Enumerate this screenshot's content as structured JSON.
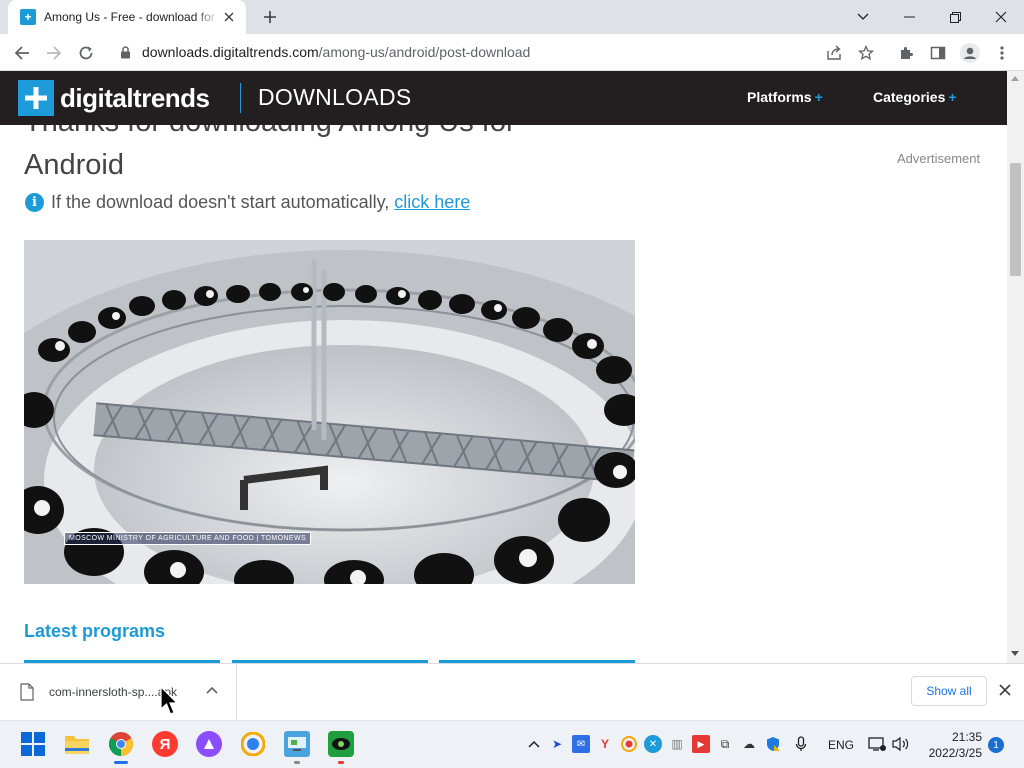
{
  "browser": {
    "tab": {
      "title": "Among Us - Free - download for",
      "favicon": "digitaltrends-favicon"
    },
    "address_bar": {
      "host": "downloads.digitaltrends.com",
      "path": "/among-us/android/post-download"
    }
  },
  "site": {
    "logo_text": "digitaltrends",
    "section": "DOWNLOADS",
    "nav": [
      {
        "label": "Platforms",
        "suffix": "+"
      },
      {
        "label": "Categories",
        "suffix": "+"
      }
    ],
    "accent_color": "#1d9bd8",
    "header_color": "#231f20"
  },
  "page": {
    "title": "Thanks for downloading Among Us for Android",
    "advertisement_label": "Advertisement",
    "notice_text": "If the download doesn't start automatically,",
    "notice_link": "click here",
    "video_caption": "MOSCOW MINISTRY OF AGRICULTURE AND FOOD | TOMONEWS",
    "latest_heading": "Latest programs"
  },
  "download_shelf": {
    "filename": "com-innersloth-sp....apk",
    "show_all_label": "Show all"
  },
  "taskbar": {
    "language": "ENG",
    "time": "21:35",
    "date": "2022/3/25",
    "notification_count": "1"
  }
}
